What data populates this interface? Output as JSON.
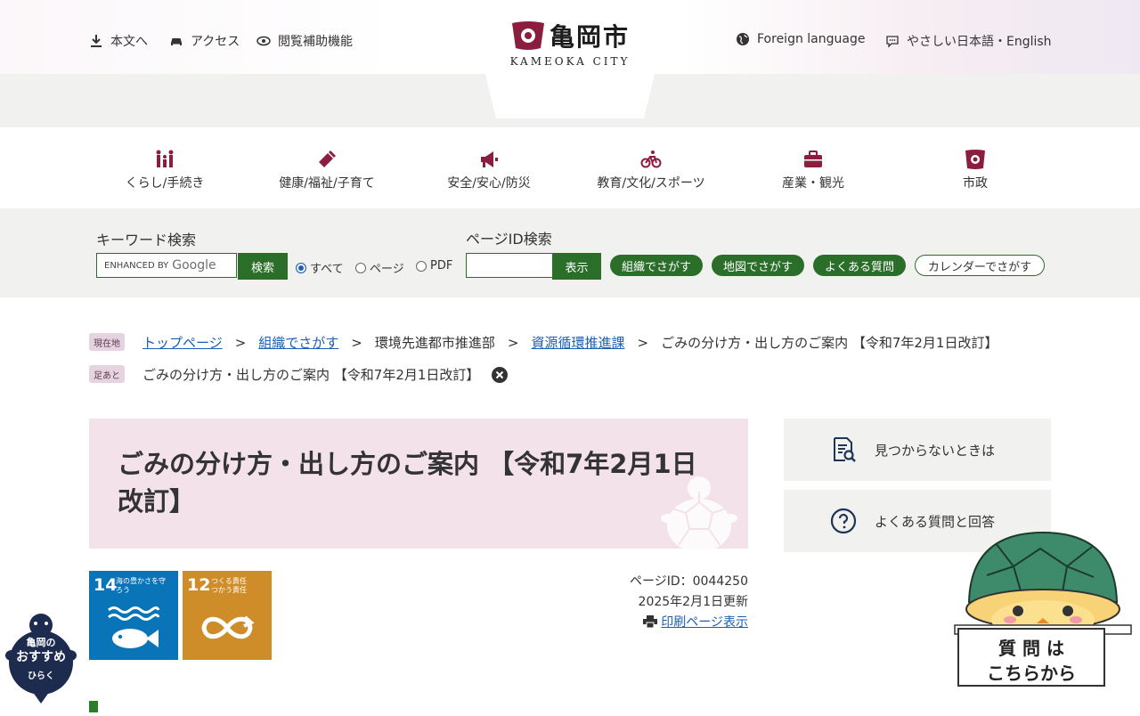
{
  "header": {
    "skip_label": "本文へ",
    "access_label": "アクセス",
    "accessibility_label": "閲覧補助機能",
    "foreign_label": "Foreign language",
    "easy_label": "やさしい日本語・English",
    "logo_kanji": "亀岡市",
    "logo_sub": "KAMEOKA CITY"
  },
  "nav": {
    "items": [
      {
        "label": "くらし/手続き",
        "icon": "family-icon"
      },
      {
        "label": "健康/福祉/子育て",
        "icon": "baby-bottle-icon"
      },
      {
        "label": "安全/安心/防災",
        "icon": "megaphone-icon"
      },
      {
        "label": "教育/文化/スポーツ",
        "icon": "bicycle-icon"
      },
      {
        "label": "産業・観光",
        "icon": "briefcase-icon"
      },
      {
        "label": "市政",
        "icon": "city-emblem-icon"
      }
    ]
  },
  "search": {
    "keyword_label": "キーワード検索",
    "google_prefix": "ENHANCED BY",
    "google_text": "Google",
    "search_button": "検索",
    "radio_all": "すべて",
    "radio_page": "ページ",
    "radio_pdf": "PDF",
    "pageid_label": "ページID検索",
    "show_button": "表示",
    "links": [
      "組織でさがす",
      "地図でさがす",
      "よくある質問",
      "カレンダーでさがす"
    ]
  },
  "breadcrumb": {
    "current_tag": "現在地",
    "items": [
      "トップページ",
      "組織でさがす",
      "環境先進都市推進部",
      "資源循環推進課",
      "ごみの分け方・出し方のご案内 【令和7年2月1日改訂】"
    ],
    "separator": ">",
    "history_tag": "足あと",
    "history_item": "ごみの分け方・出し方のご案内 【令和7年2月1日改訂】"
  },
  "page": {
    "title": "ごみの分け方・出し方のご案内 【令和7年2月1日改訂】",
    "page_id": "ページID：0044250",
    "updated": "2025年2月1日更新",
    "print_link": "印刷ページ表示"
  },
  "sdgs": [
    {
      "number": "14",
      "text": "海の豊かさを守ろう",
      "color": "#0a74b9"
    },
    {
      "number": "12",
      "text": "つくる責任 つかう責任",
      "color": "#cf8d2a"
    }
  ],
  "sidebar": {
    "not_found": "見つからないときは",
    "faq": "よくある質問と回答"
  },
  "widgets": {
    "recommend_line1": "亀岡の",
    "recommend_line2": "おすすめ",
    "recommend_line3": "ひらく",
    "question_line1": "質 問 は",
    "question_line2": "こちらから"
  },
  "colors": {
    "accent_green": "#2a6e2a",
    "title_bg": "#f4e2ea",
    "brand_maroon": "#8b1e3f"
  }
}
